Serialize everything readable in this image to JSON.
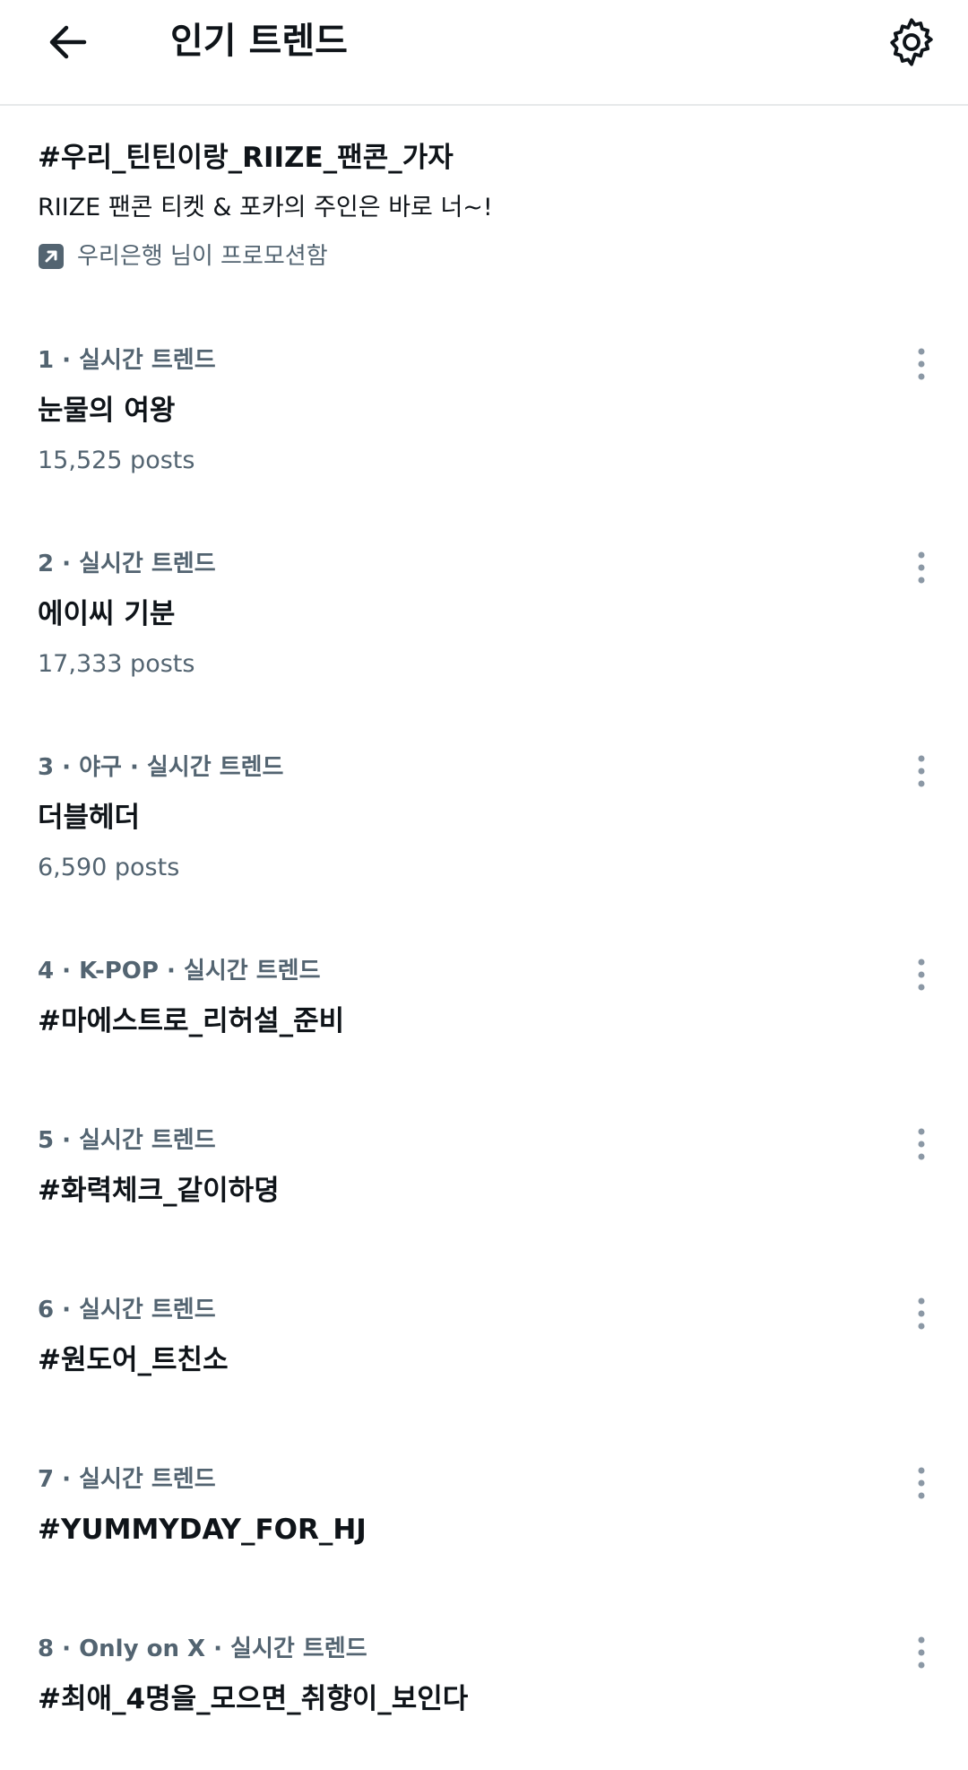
{
  "header": {
    "title": "인기 트렌드",
    "back_icon": "arrow-left-icon",
    "settings_icon": "gear-icon"
  },
  "promoted": {
    "title": "#우리_틴틴이랑_RIIZE_팬콘_가자",
    "description": "RIIZE 팬콘 티켓 & 포카의 주인은 바로 너~!",
    "promoted_by": "우리은행 님이 프로모션함",
    "icon": "promoted-arrow-icon"
  },
  "trends": [
    {
      "meta": "1 · 실시간 트렌드",
      "name": "눈물의 여왕",
      "count": "15,525 posts"
    },
    {
      "meta": "2 · 실시간 트렌드",
      "name": "에이씨 기분",
      "count": "17,333 posts"
    },
    {
      "meta": "3 · 야구 · 실시간 트렌드",
      "name": "더블헤더",
      "count": "6,590 posts"
    },
    {
      "meta": "4 · K-POP · 실시간 트렌드",
      "name": "#마에스트로_리허설_준비",
      "count": ""
    },
    {
      "meta": "5 · 실시간 트렌드",
      "name": "#화력체크_같이하뎡",
      "count": ""
    },
    {
      "meta": "6 · 실시간 트렌드",
      "name": "#원도어_트친소",
      "count": ""
    },
    {
      "meta": "7 · 실시간 트렌드",
      "name": "#YUMMYDAY_FOR_HJ",
      "count": ""
    },
    {
      "meta": "8 · Only on X · 실시간 트렌드",
      "name": "#최애_4명을_모으면_취향이_보인다",
      "count": ""
    }
  ],
  "colors": {
    "text_primary": "#0f1419",
    "text_secondary": "#536471",
    "divider": "#e7e9ea",
    "more_dots": "#8b98a5"
  }
}
